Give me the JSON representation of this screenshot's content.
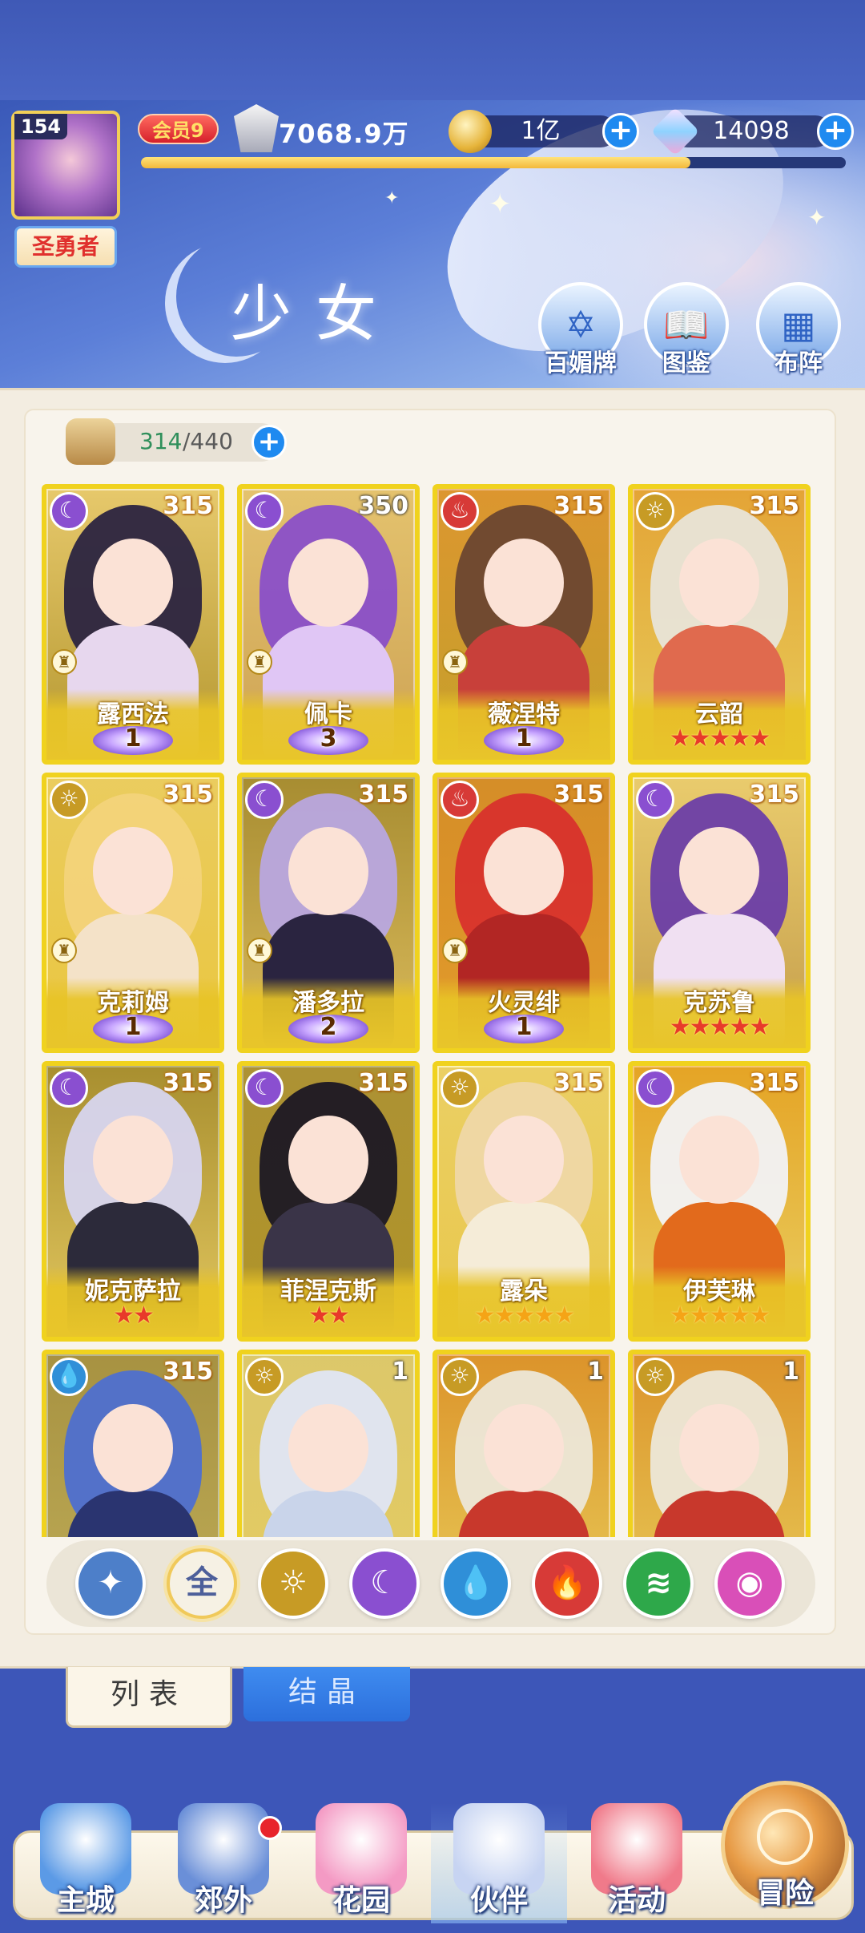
{
  "player": {
    "level": "154",
    "rank": "圣勇者",
    "vip": "会员9",
    "power": "7068.9万",
    "exp_progress": 0.78
  },
  "currencies": [
    {
      "icon": "gold-coin-icon",
      "value": "1亿"
    },
    {
      "icon": "crystal-gem-icon",
      "value": "14098"
    }
  ],
  "banner": {
    "title": "少女",
    "buttons": [
      {
        "label": "百媚牌",
        "icon": "hexagram-card-icon"
      },
      {
        "label": "图鉴",
        "icon": "book-icon"
      },
      {
        "label": "布阵",
        "icon": "grid-formation-icon"
      }
    ]
  },
  "capacity": {
    "current": "314",
    "max": "/440"
  },
  "cards": [
    {
      "name": "露西法",
      "level": "315",
      "element": "moon",
      "grade": "wing",
      "wing_num": "1",
      "palette": [
        "#2b2440",
        "#e7d7ee"
      ]
    },
    {
      "name": "佩卡",
      "level": "350",
      "element": "moon",
      "grade": "wing",
      "wing_num": "3",
      "palette": [
        "#8a4fc9",
        "#e0c6f5"
      ]
    },
    {
      "name": "薇涅特",
      "level": "315",
      "element": "fire",
      "grade": "wing",
      "wing_num": "1",
      "palette": [
        "#6b4630",
        "#c8403a"
      ]
    },
    {
      "name": "云韶",
      "level": "315",
      "element": "sun",
      "grade": "stars",
      "stars": "★★★★★",
      "palette": [
        "#e8e4d8",
        "#e06a4e"
      ]
    },
    {
      "name": "克莉姆",
      "level": "315",
      "element": "sun",
      "grade": "wing",
      "wing_num": "1",
      "palette": [
        "#f3d37a",
        "#f4e2c8"
      ]
    },
    {
      "name": "潘多拉",
      "level": "315",
      "element": "moon",
      "grade": "wing",
      "wing_num": "2",
      "palette": [
        "#b8a6e0",
        "#2a2440"
      ]
    },
    {
      "name": "火灵绯",
      "level": "315",
      "element": "fire",
      "grade": "wing",
      "wing_num": "1",
      "palette": [
        "#d8322c",
        "#b22624"
      ]
    },
    {
      "name": "克苏鲁",
      "level": "315",
      "element": "moon",
      "grade": "stars",
      "stars": "★★★★★",
      "palette": [
        "#6b3ea8",
        "#f0e0f2"
      ]
    },
    {
      "name": "妮克萨拉",
      "level": "315",
      "element": "moon",
      "grade": "stars2",
      "stars": "★★",
      "palette": [
        "#d7d5ef",
        "#2c2a3a"
      ]
    },
    {
      "name": "菲涅克斯",
      "level": "315",
      "element": "moon",
      "grade": "stars2",
      "stars": "★★",
      "palette": [
        "#1c1824",
        "#3a3448"
      ]
    },
    {
      "name": "露朵",
      "level": "315",
      "element": "sun",
      "grade": "goldstars",
      "stars": "★★★★★",
      "palette": [
        "#efd7a6",
        "#f5ecd8"
      ]
    },
    {
      "name": "伊芙琳",
      "level": "315",
      "element": "moon",
      "grade": "goldstars",
      "stars": "★★★★★",
      "palette": [
        "#f2f2f6",
        "#e26a1c"
      ]
    },
    {
      "name": "",
      "level": "315",
      "element": "water",
      "grade": "none",
      "palette": [
        "#4e6fd0",
        "#2a3470"
      ]
    },
    {
      "name": "",
      "level": "1",
      "element": "sun",
      "grade": "none",
      "palette": [
        "#dfe6f5",
        "#c9d4ea"
      ]
    },
    {
      "name": "",
      "level": "1",
      "element": "sun",
      "grade": "none",
      "palette": [
        "#ece7d8",
        "#c8382c"
      ]
    },
    {
      "name": "",
      "level": "1",
      "element": "sun",
      "grade": "none",
      "palette": [
        "#ece7d8",
        "#c8382c"
      ]
    }
  ],
  "filters": [
    {
      "name": "filter-wind",
      "glyph": "✦",
      "color": "#4d7fc9"
    },
    {
      "name": "filter-all",
      "glyph": "全",
      "color": "#f6f1e4",
      "selected": true
    },
    {
      "name": "filter-sun",
      "glyph": "☼",
      "color": "#c79b25"
    },
    {
      "name": "filter-moon",
      "glyph": "☾",
      "color": "#8a4fd0"
    },
    {
      "name": "filter-water",
      "glyph": "💧",
      "color": "#2f8fd8"
    },
    {
      "name": "filter-fire",
      "glyph": "🔥",
      "color": "#d73a37"
    },
    {
      "name": "filter-wind2",
      "glyph": "≋",
      "color": "#2ea84a"
    },
    {
      "name": "filter-star",
      "glyph": "◉",
      "color": "#d94fb8"
    }
  ],
  "tabs": {
    "list": "列表",
    "crystal": "结晶"
  },
  "nav": [
    {
      "label": "主城",
      "icon": "castle-icon"
    },
    {
      "label": "郊外",
      "icon": "magic-circle-icon"
    },
    {
      "label": "花园",
      "icon": "heart-icon"
    },
    {
      "label": "伙伴",
      "icon": "partner-portrait-icon",
      "active": true
    },
    {
      "label": "活动",
      "icon": "gift-box-icon"
    },
    {
      "label": "冒险",
      "icon": "compass-sword-icon"
    }
  ],
  "colors": {
    "accent_blue": "#1f8af0",
    "card_gold": "#f0d21e",
    "panel": "#f3ede1"
  }
}
